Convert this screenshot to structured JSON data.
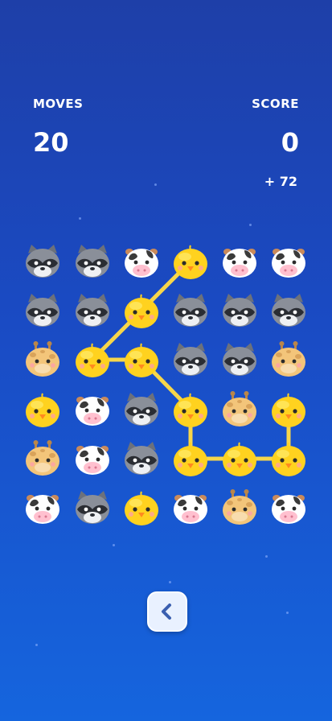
{
  "hud": {
    "moves_label": "MOVES",
    "moves_value": "20",
    "score_label": "SCORE",
    "score_value": "0",
    "score_gain": "+ 72"
  },
  "colors": {
    "background_top": "#1e3fa8",
    "background_bottom": "#1565de",
    "path": "#f7d64a",
    "chick": "#ffd21f",
    "cow_spot": "#3a3a3a",
    "giraffe": "#f3c57a",
    "raccoon": "#8a8f99"
  },
  "grid": {
    "rows": [
      [
        "raccoon",
        "raccoon",
        "cow",
        "chick",
        "cow",
        "cow"
      ],
      [
        "raccoon",
        "raccoon",
        "chick",
        "raccoon",
        "raccoon",
        "raccoon"
      ],
      [
        "giraffe",
        "chick",
        "chick",
        "raccoon",
        "raccoon",
        "giraffe"
      ],
      [
        "chick",
        "cow",
        "raccoon",
        "chick",
        "giraffe",
        "chick"
      ],
      [
        "giraffe",
        "cow",
        "raccoon",
        "chick",
        "chick",
        "chick"
      ],
      [
        "cow",
        "raccoon",
        "chick",
        "cow",
        "giraffe",
        "cow"
      ]
    ],
    "selected_path": [
      [
        0,
        3
      ],
      [
        1,
        2
      ],
      [
        2,
        1
      ],
      [
        2,
        2
      ],
      [
        3,
        3
      ],
      [
        4,
        3
      ],
      [
        4,
        4
      ],
      [
        4,
        5
      ],
      [
        3,
        5
      ]
    ]
  },
  "back_button": {
    "icon": "chevron-left-icon"
  }
}
